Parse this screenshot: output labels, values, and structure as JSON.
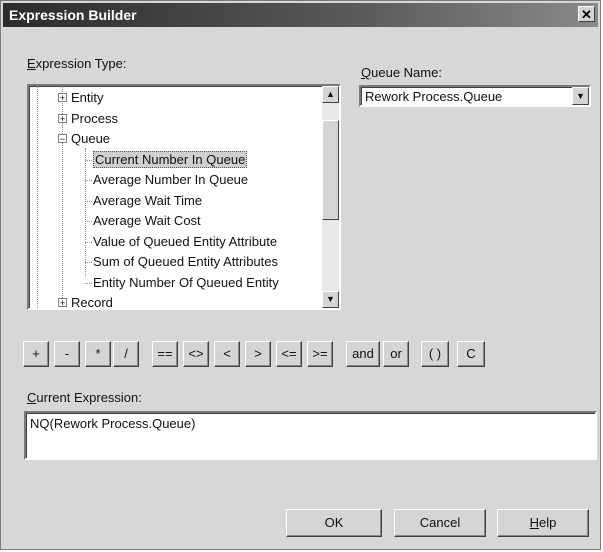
{
  "window": {
    "title": "Expression Builder",
    "close_glyph": "✕"
  },
  "expression_type": {
    "label_u": "E",
    "label_rest": "xpression Type:",
    "tree": [
      {
        "label": "Entity",
        "expander": "+",
        "level": 0
      },
      {
        "label": "Process",
        "expander": "+",
        "level": 0
      },
      {
        "label": "Queue",
        "expander": "−",
        "level": 0
      },
      {
        "label": "Current Number In Queue",
        "level": 1,
        "selected": true
      },
      {
        "label": "Average Number In Queue",
        "level": 1
      },
      {
        "label": "Average Wait Time",
        "level": 1
      },
      {
        "label": "Average Wait Cost",
        "level": 1
      },
      {
        "label": "Value of Queued Entity Attribute",
        "level": 1
      },
      {
        "label": "Sum of Queued Entity Attributes",
        "level": 1
      },
      {
        "label": "Entity Number Of Queued Entity",
        "level": 1
      },
      {
        "label": "Record",
        "expander": "+",
        "level": 0
      }
    ]
  },
  "queue_name": {
    "label_u": "Q",
    "label_rest": "ueue Name:",
    "value": "Rework Process.Queue"
  },
  "operators": {
    "plus": "+",
    "minus": "-",
    "times": "*",
    "divide": "/",
    "eq": "==",
    "ne": "<>",
    "lt": "<",
    "gt": ">",
    "le": "<=",
    "ge": ">=",
    "and": "and",
    "or": "or",
    "parens": "( )",
    "clear": "C"
  },
  "current_expression": {
    "label_u": "C",
    "label_rest": "urrent Expression:",
    "value": "NQ(Rework Process.Queue)"
  },
  "footer": {
    "ok": "OK",
    "cancel": "Cancel",
    "help_u": "H",
    "help_rest": "elp"
  },
  "icons": {
    "scroll_up": "up-arrow-icon",
    "scroll_down": "down-arrow-icon",
    "dropdown": "dropdown-arrow-icon"
  }
}
